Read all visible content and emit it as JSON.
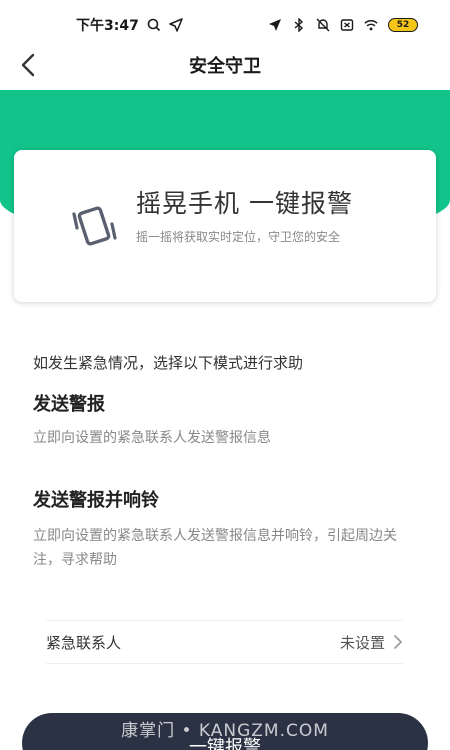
{
  "status_bar": {
    "time": "下午3:47",
    "battery": "52"
  },
  "nav": {
    "title": "安全守卫"
  },
  "card": {
    "title": "摇晃手机 一键报警",
    "subtitle": "摇一摇将获取实时定位，守卫您的安全"
  },
  "intro": "如发生紧急情况，选择以下模式进行求助",
  "modes": [
    {
      "title": "发送警报",
      "desc": "立即向设置的紧急联系人发送警报信息"
    },
    {
      "title": "发送警报并响铃",
      "desc": "立即向设置的紧急联系人发送警报信息并响铃，引起周边关注，寻求帮助"
    }
  ],
  "contact": {
    "label": "紧急联系人",
    "value": "未设置"
  },
  "alarm_button": {
    "label": "一键报警"
  },
  "watermark": "康掌门 • KANGZM.COM",
  "colors": {
    "accent_green": "#12c48a",
    "button_dark": "#2b3244",
    "battery_yellow": "#f5c518"
  }
}
